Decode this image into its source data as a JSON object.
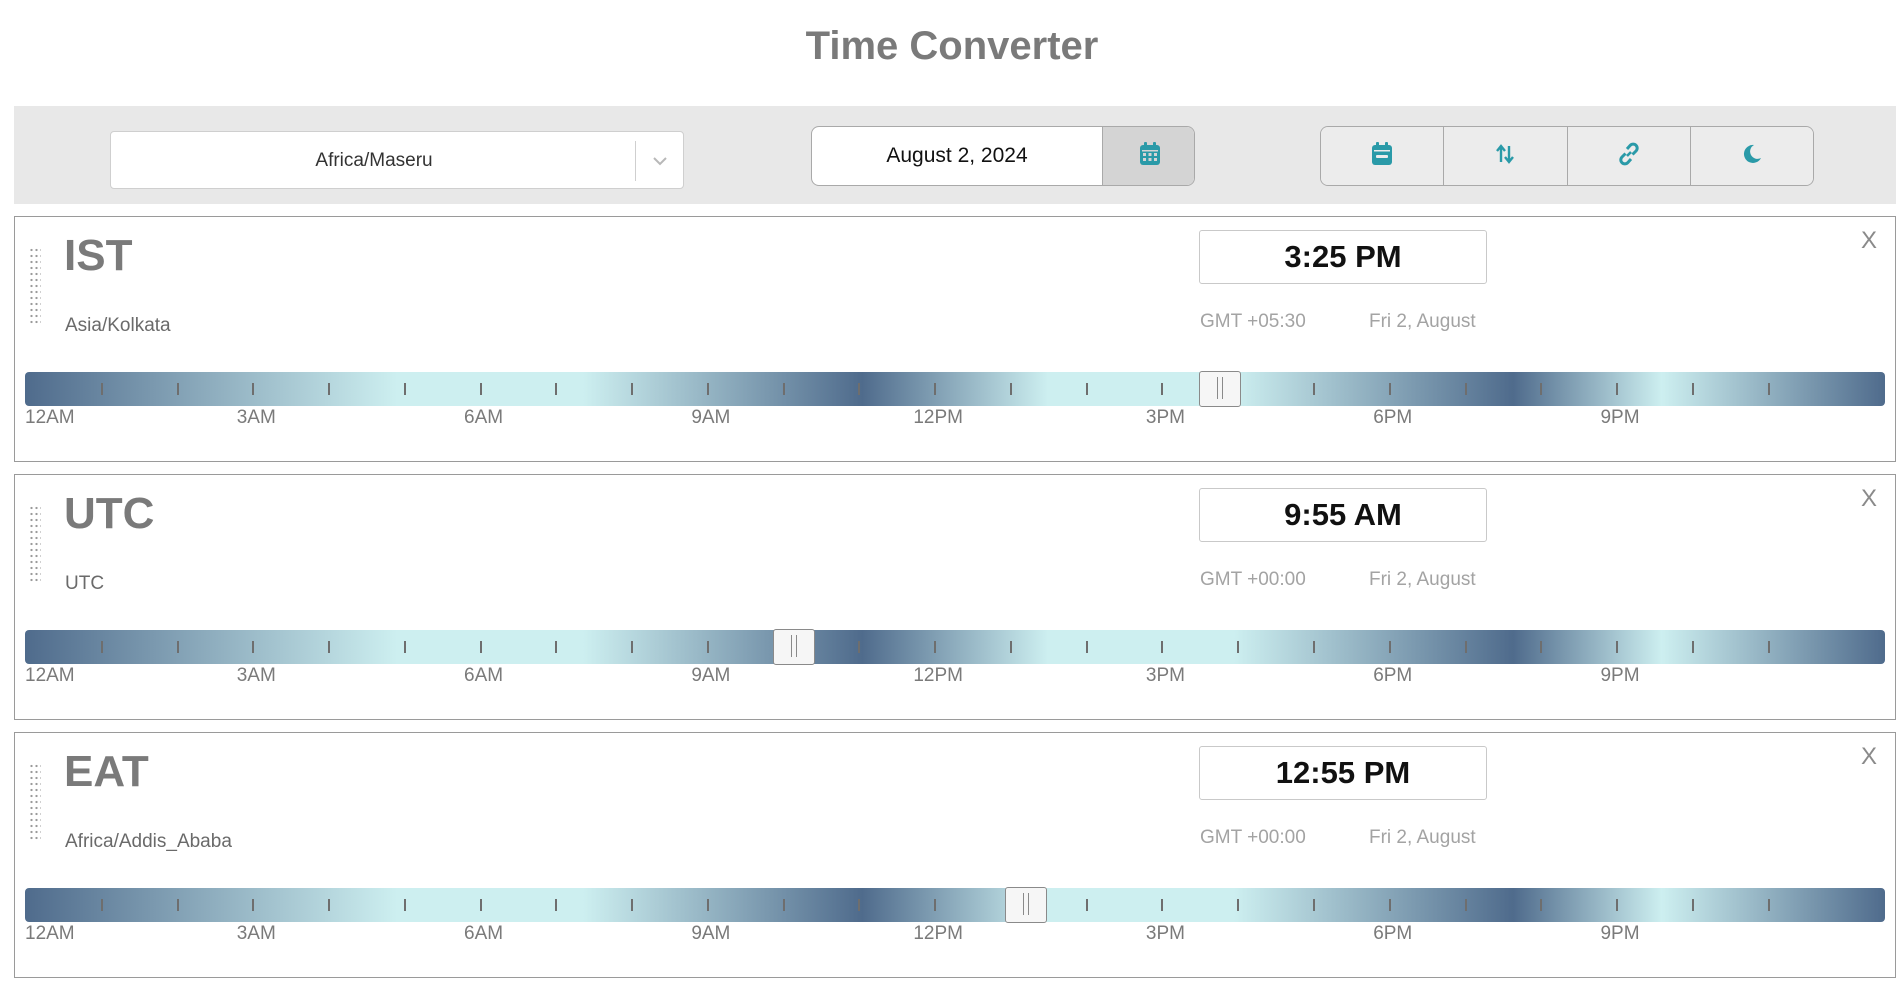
{
  "page": {
    "title": "Time Converter"
  },
  "toolbar": {
    "timezone_select": {
      "value": "Africa/Maseru"
    },
    "date_picker": {
      "value": "August 2, 2024"
    },
    "icons": [
      "calendar-icon",
      "sort-icon",
      "link-icon",
      "moon-icon"
    ],
    "accent_color": "#2a9aa8"
  },
  "hour_labels": [
    "12AM",
    "3AM",
    "6AM",
    "9AM",
    "12PM",
    "3PM",
    "6PM",
    "9PM"
  ],
  "cards": [
    {
      "abbr": "IST",
      "zone": "Asia/Kolkata",
      "time": "3:25 PM",
      "offset": "GMT +05:30",
      "date": "Fri 2, August",
      "close": "X",
      "slider_hour": 15.42
    },
    {
      "abbr": "UTC",
      "zone": "UTC",
      "time": "9:55 AM",
      "offset": "GMT +00:00",
      "date": "Fri 2, August",
      "close": "X",
      "slider_hour": 9.92
    },
    {
      "abbr": "EAT",
      "zone": "Africa/Addis_Ababa",
      "time": "12:55 PM",
      "offset": "GMT +00:00",
      "date": "Fri 2, August",
      "close": "X",
      "slider_hour": 12.92
    }
  ],
  "track_colors": {
    "night": "#4f6b8c",
    "day": "#cdeff0"
  }
}
